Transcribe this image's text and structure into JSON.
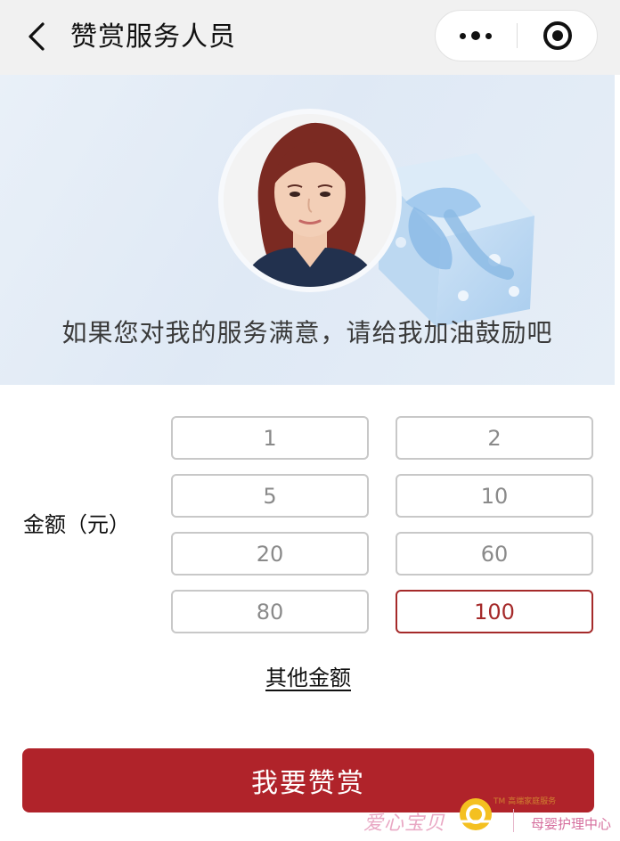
{
  "nav": {
    "title": "赞赏服务人员",
    "back_icon": "chevron-left-icon",
    "more_icon": "more-dots-icon",
    "close_icon": "target-close-icon"
  },
  "banner": {
    "message": "如果您对我的服务满意，请给我加油鼓励吧",
    "avatar": "staff-portrait"
  },
  "amount": {
    "label": "金额（元）",
    "options": [
      "1",
      "2",
      "5",
      "10",
      "20",
      "60",
      "80",
      "100"
    ],
    "selected": "100",
    "other_label": "其他金额"
  },
  "submit_label": "我要赞赏",
  "watermark": {
    "brand": "爱心宝贝",
    "tagline": "高端家庭服务",
    "tm": "TM",
    "sub": "母婴护理中心"
  },
  "colors": {
    "accent": "#b0232a",
    "selected_border": "#a52a2a",
    "nav_bg": "#f1f1f1",
    "option_border": "#c8c8c8"
  }
}
